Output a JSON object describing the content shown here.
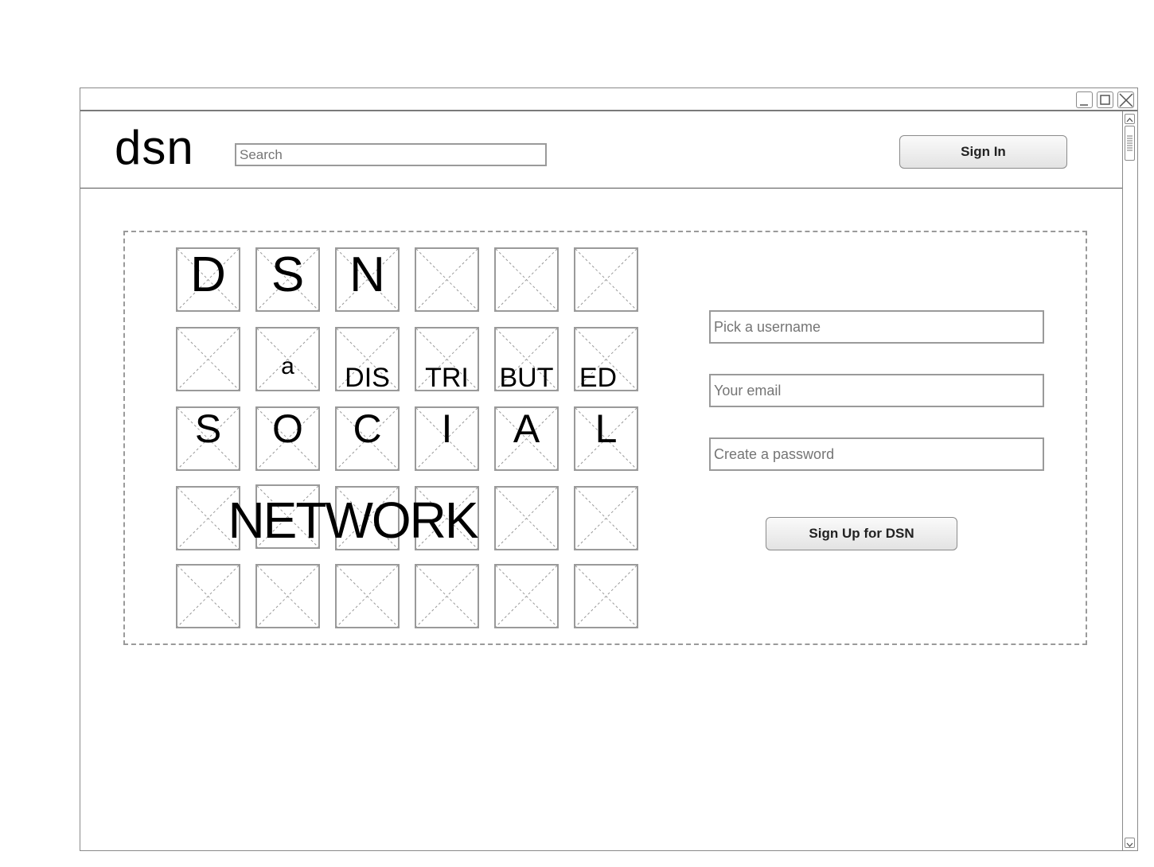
{
  "window": {
    "controls": [
      "minimize-icon",
      "maximize-icon",
      "close-icon"
    ]
  },
  "header": {
    "logo": "dsn",
    "search_placeholder": "Search",
    "sign_in_label": "Sign In"
  },
  "mosaic": {
    "letters": {
      "r1": [
        "D",
        "S",
        "N"
      ],
      "r2": [
        "a",
        "DIS",
        "TRI",
        "BUT",
        "ED"
      ],
      "r3": [
        "S",
        "O",
        "C",
        "I",
        "A",
        "L"
      ],
      "r4": "NETWORK"
    }
  },
  "signup_form": {
    "username_placeholder": "Pick a username",
    "email_placeholder": "Your email",
    "password_placeholder": "Create a password",
    "submit_label": "Sign Up for DSN"
  }
}
